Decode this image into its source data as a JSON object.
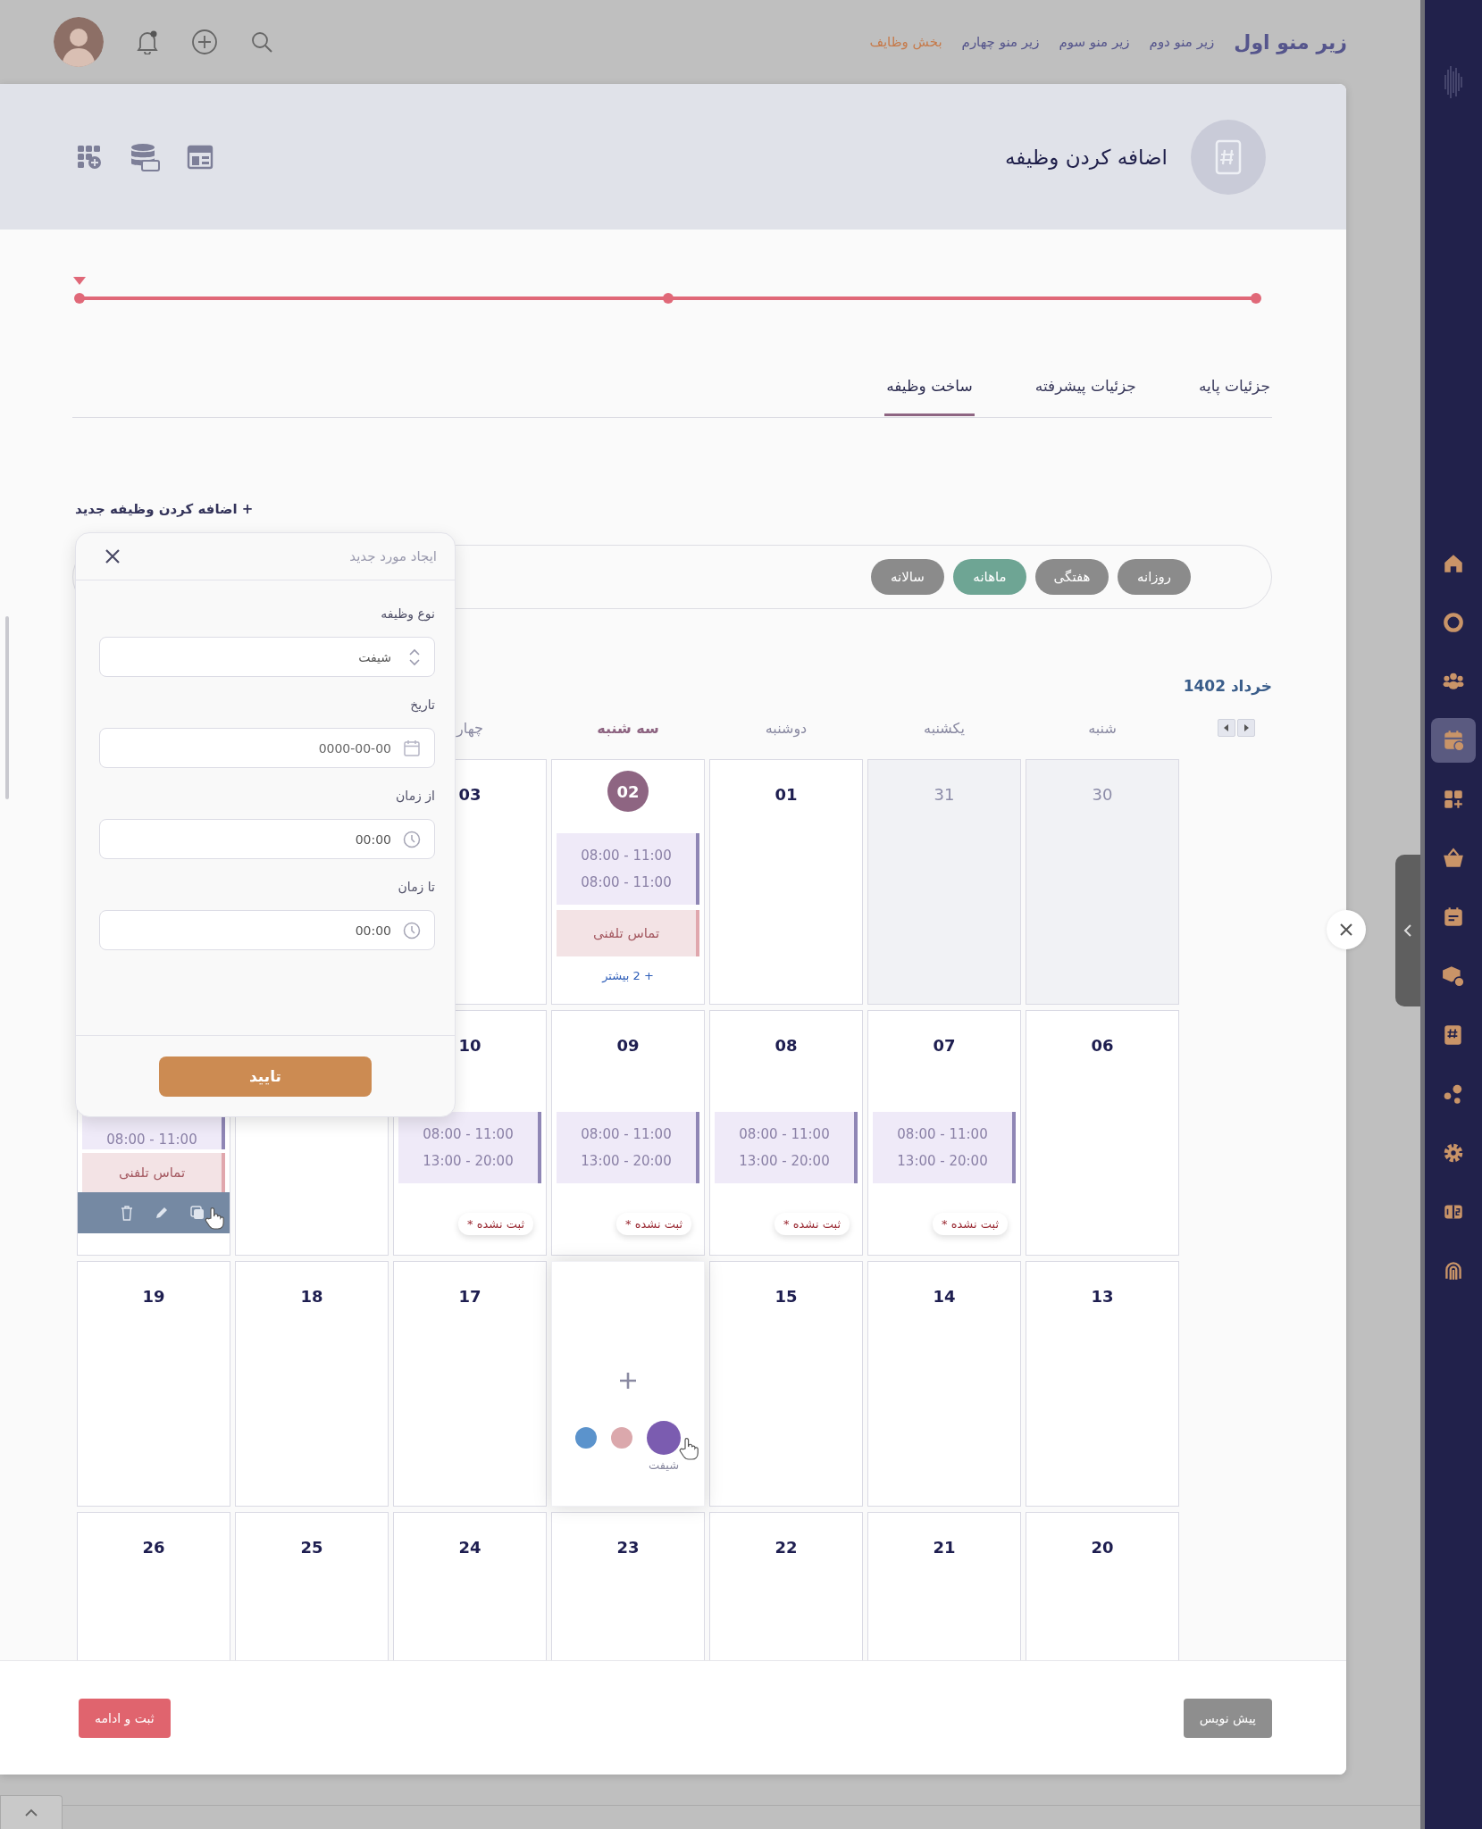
{
  "top_bar": {
    "menu": [
      {
        "label": "زیر منو اول",
        "kind": "brand",
        "selected": false
      },
      {
        "label": "زیر منو دوم",
        "kind": "link",
        "selected": false
      },
      {
        "label": "زیر منو سوم",
        "kind": "link",
        "selected": false
      },
      {
        "label": "زیر منو چهارم",
        "kind": "link",
        "selected": false
      },
      {
        "label": "بخش وظایف",
        "kind": "link",
        "selected": true
      }
    ]
  },
  "header": {
    "title": "اضافه کردن وظیفه"
  },
  "stepper": {
    "level": 1
  },
  "tabs": [
    {
      "label": "جزئیات پایه",
      "selected": false
    },
    {
      "label": "جزئیات پیشرفته",
      "selected": false
    },
    {
      "label": "ساخت وظیفه",
      "selected": true
    }
  ],
  "add_link": "+ اضافه کردن وظیفه جدید",
  "views": [
    {
      "label": "روزانه",
      "selected": false
    },
    {
      "label": "هفتگی",
      "selected": false
    },
    {
      "label": "ماهانه",
      "selected": true
    },
    {
      "label": "سالانه",
      "selected": false
    }
  ],
  "calendar": {
    "title": "خرداد 1402",
    "weekdays": [
      {
        "label": "شنبه",
        "selected": false
      },
      {
        "label": "یکشنبه",
        "selected": false
      },
      {
        "label": "دوشنبه",
        "selected": false
      },
      {
        "label": "سه شنبه",
        "selected": true
      },
      {
        "label": "چهار",
        "selected": false
      }
    ],
    "weeks": [
      [
        {
          "kind": "day",
          "day": "30",
          "muted": true,
          "today": false
        },
        {
          "kind": "day",
          "day": "31",
          "muted": true,
          "today": false
        },
        {
          "kind": "day",
          "day": "01",
          "muted": false,
          "today": false
        },
        {
          "kind": "day",
          "day": "02",
          "muted": false,
          "today": true,
          "events": [
            {
              "kind": "shift",
              "times": [
                "08:00 - 11:00",
                "08:00 - 11:00"
              ]
            },
            {
              "kind": "call",
              "title": "تماس تلفنی",
              "show_actions": false
            }
          ],
          "more": "+ 2 بیشتر"
        },
        {
          "kind": "day",
          "day": "03",
          "muted": false,
          "today": false
        },
        {
          "kind": "covered"
        },
        {
          "kind": "covered"
        }
      ],
      [
        {
          "kind": "day",
          "day": "06",
          "muted": false,
          "today": false
        },
        {
          "kind": "day",
          "day": "07",
          "muted": false,
          "today": false,
          "events": [
            {
              "kind": "shift",
              "times": [
                "08:00 - 11:00",
                "13:00 - 20:00"
              ]
            }
          ],
          "status": "ثبت نشده *"
        },
        {
          "kind": "day",
          "day": "08",
          "muted": false,
          "today": false,
          "events": [
            {
              "kind": "shift",
              "times": [
                "08:00 - 11:00",
                "13:00 - 20:00"
              ]
            }
          ],
          "status": "ثبت نشده *"
        },
        {
          "kind": "day",
          "day": "09",
          "muted": false,
          "today": false,
          "events": [
            {
              "kind": "shift",
              "times": [
                "08:00 - 11:00",
                "13:00 - 20:00"
              ]
            }
          ],
          "status": "ثبت نشده *"
        },
        {
          "kind": "day",
          "day": "10",
          "muted": false,
          "today": false,
          "events": [
            {
              "kind": "shift",
              "times": [
                "08:00 - 11:00",
                "13:00 - 20:00"
              ]
            }
          ],
          "status": "ثبت نشده *"
        },
        {
          "kind": "day"
        },
        {
          "kind": "day",
          "events": [
            {
              "kind": "shift",
              "times": [
                "08:00 - 11:00"
              ]
            },
            {
              "kind": "call",
              "title": "تماس تلفنی",
              "show_actions": true
            }
          ]
        }
      ],
      [
        {
          "kind": "day",
          "day": "13",
          "muted": false,
          "today": false
        },
        {
          "kind": "day",
          "day": "14",
          "muted": false,
          "today": false
        },
        {
          "kind": "day",
          "day": "15",
          "muted": false,
          "today": false
        },
        {
          "kind": "hover",
          "dots": [
            {
              "color": "#5b93cc",
              "selected": false
            },
            {
              "color": "#dba8ac",
              "selected": false
            },
            {
              "color": "#7b5cb0",
              "selected": true,
              "label": "شیفت"
            }
          ]
        },
        {
          "kind": "day",
          "day": "17",
          "muted": false,
          "today": false
        },
        {
          "kind": "day",
          "day": "18",
          "muted": false,
          "today": false
        },
        {
          "kind": "day",
          "day": "19",
          "muted": false,
          "today": false
        }
      ],
      [
        {
          "kind": "day",
          "day": "20",
          "muted": false,
          "today": false
        },
        {
          "kind": "day",
          "day": "21",
          "muted": false,
          "today": false
        },
        {
          "kind": "day",
          "day": "22",
          "muted": false,
          "today": false
        },
        {
          "kind": "day",
          "day": "23",
          "muted": false,
          "today": false
        },
        {
          "kind": "day",
          "day": "24",
          "muted": false,
          "today": false
        },
        {
          "kind": "day",
          "day": "25",
          "muted": false,
          "today": false
        },
        {
          "kind": "day",
          "day": "26",
          "muted": false,
          "today": false
        }
      ]
    ]
  },
  "popup": {
    "title": "ایجاد مورد جدید",
    "fields": [
      {
        "label": "نوع وظیفه",
        "kind": "select",
        "value": "شیفت"
      },
      {
        "label": "تاریخ",
        "kind": "date",
        "placeholder": "0000-00-00"
      },
      {
        "label": "از زمان",
        "kind": "time",
        "value": "00:00"
      },
      {
        "label": "تا زمان",
        "kind": "time",
        "value": "00:00"
      }
    ],
    "confirm": "تایید"
  },
  "footer": {
    "buttons": [
      {
        "label": "پیش نویس",
        "kind": "draft"
      },
      {
        "label": "ثبت و ادامه",
        "kind": "submit"
      }
    ]
  },
  "side_rail": {
    "items": [
      {
        "selected": false
      },
      {
        "selected": false
      },
      {
        "selected": false
      },
      {
        "selected": true
      },
      {
        "selected": false
      },
      {
        "selected": false
      },
      {
        "selected": false
      },
      {
        "selected": false
      },
      {
        "selected": false
      },
      {
        "selected": false
      },
      {
        "selected": false
      },
      {
        "selected": false
      },
      {
        "selected": false
      }
    ]
  }
}
